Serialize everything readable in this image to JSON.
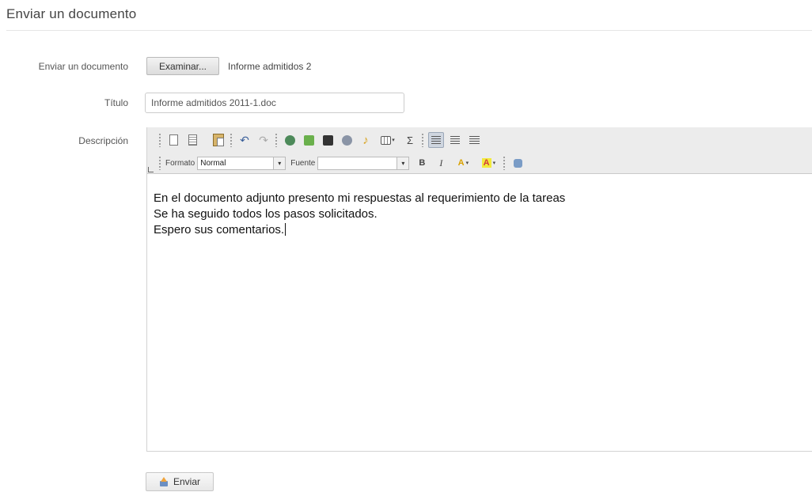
{
  "page": {
    "title": "Enviar un documento"
  },
  "form": {
    "file_label": "Enviar un documento",
    "browse_button": "Examinar...",
    "selected_file": "Informe admitidos 2",
    "title_label": "Título",
    "title_value": "Informe admitidos 2011-1.doc",
    "description_label": "Descripción",
    "submit_button": "Enviar"
  },
  "toolbar": {
    "format_label": "Formato",
    "format_value": "Normal",
    "font_label": "Fuente",
    "font_value": "",
    "bold": "B",
    "italic": "I",
    "undo": "↶",
    "redo": "↷",
    "sigma": "Σ",
    "music": "♪",
    "font_color": "A",
    "bg_color": "A"
  },
  "editor": {
    "lines": [
      "En el documento adjunto presento mi respuestas al requerimiento de la tareas",
      "Se ha seguido todos los pasos solicitados.",
      "Espero sus comentarios."
    ]
  },
  "colors": {
    "toolbar_bg": "#ececec",
    "active_button": "#cfd6e0"
  }
}
